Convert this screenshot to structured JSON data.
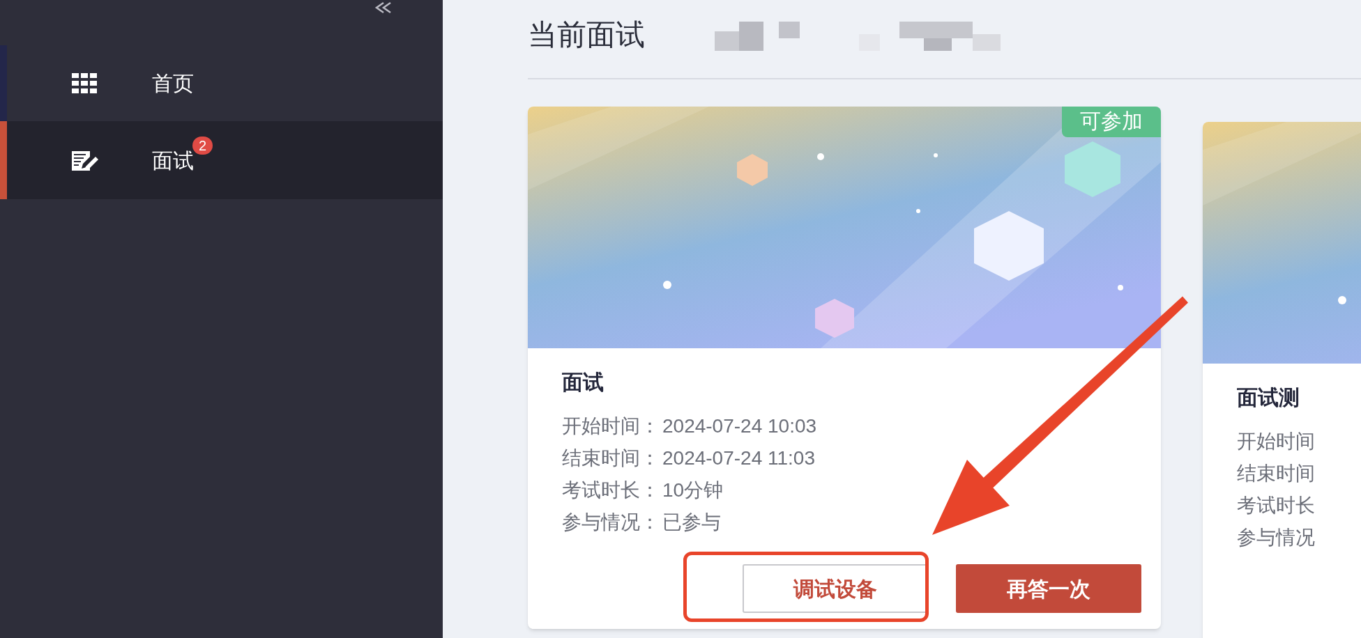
{
  "sidebar": {
    "items": [
      {
        "label": "首页",
        "kind": "grid",
        "selected": false
      },
      {
        "label": "面试",
        "kind": "edit",
        "selected": true,
        "badge": "2"
      }
    ]
  },
  "page": {
    "title": "当前面试"
  },
  "cards": [
    {
      "status": "可参加",
      "title": "面试",
      "fields": [
        {
          "label": "开始时间：",
          "value": "2024-07-24 10:03"
        },
        {
          "label": "结束时间：",
          "value": "2024-07-24 11:03"
        },
        {
          "label": "考试时长：",
          "value": "10分钟"
        },
        {
          "label": "参与情况：",
          "value": "已参与"
        }
      ],
      "buttons": [
        {
          "label": "调试设备",
          "kind": "outline"
        },
        {
          "label": "再答一次",
          "kind": "primary"
        }
      ]
    },
    {
      "title": "面试测",
      "fields": [
        {
          "label": "开始时间"
        },
        {
          "label": "结束时间"
        },
        {
          "label": "考试时长"
        },
        {
          "label": "参与情况"
        }
      ]
    }
  ]
}
